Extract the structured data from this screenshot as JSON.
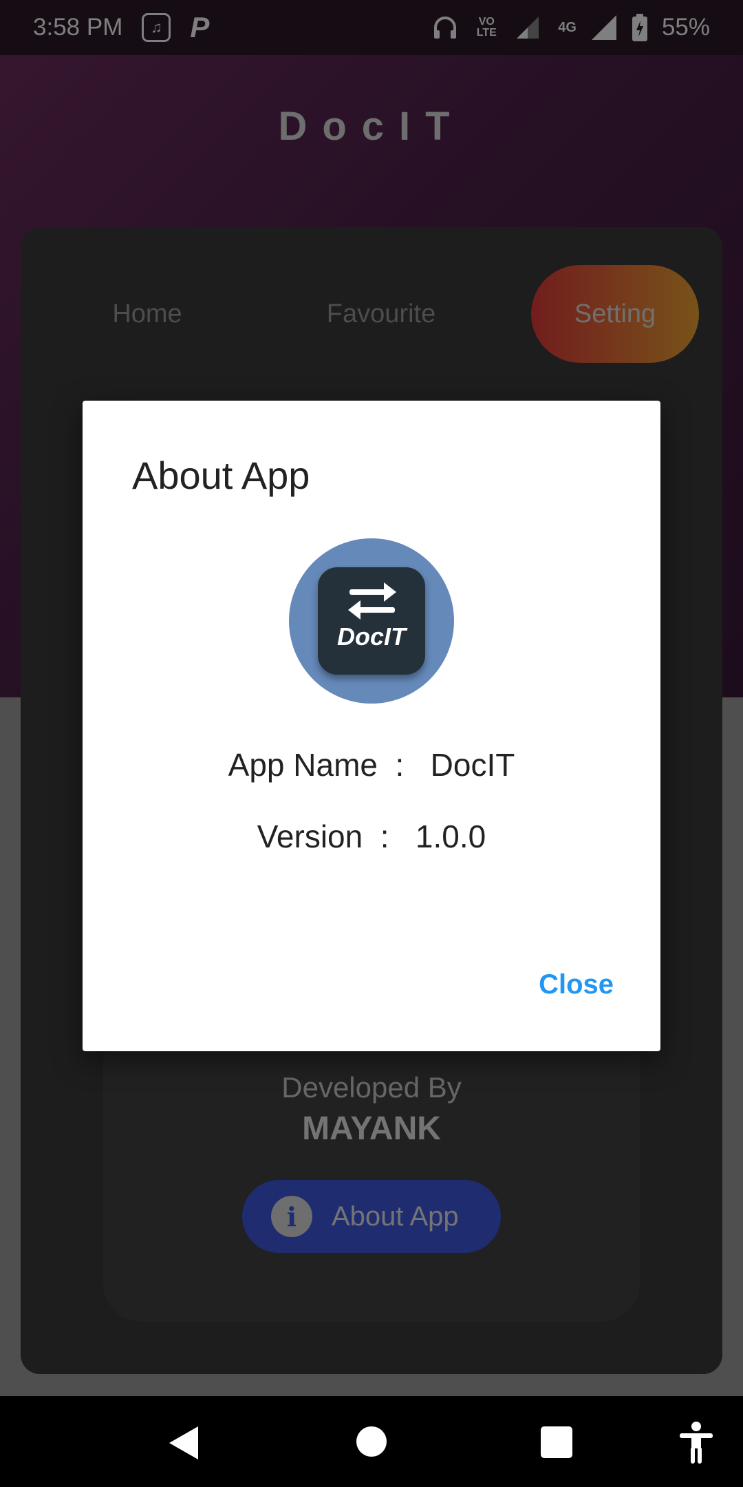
{
  "status_bar": {
    "time": "3:58 PM",
    "network": "4G",
    "battery": "55%",
    "volte": "VO LTE"
  },
  "app": {
    "title": "DocIT",
    "tabs": [
      {
        "label": "Home"
      },
      {
        "label": "Favourite"
      },
      {
        "label": "Setting"
      }
    ],
    "developed_by_label": "Developed By",
    "developer_name": "MAYANK",
    "about_button_label": "About App"
  },
  "dialog": {
    "title": "About App",
    "logo_text": "DocIT",
    "app_name_line": "App Name  :   DocIT",
    "version_line": "Version  :   1.0.0",
    "close_label": "Close"
  },
  "colors": {
    "tab_active_gradient_start": "#e43b3b",
    "tab_active_gradient_end": "#f0a533",
    "about_button": "#3f58e0",
    "close_link": "#2196f3",
    "logo_circle": "#6589b9"
  }
}
